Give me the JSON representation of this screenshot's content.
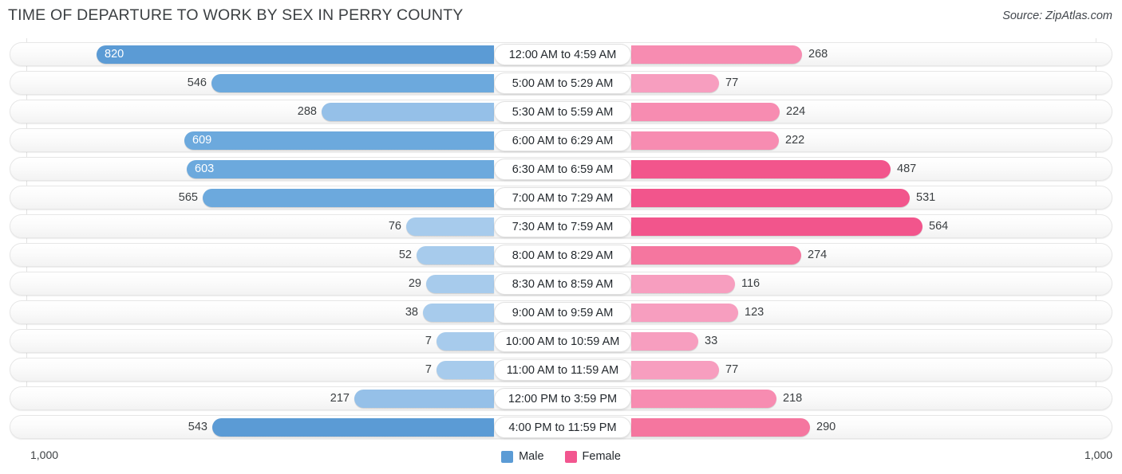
{
  "header": {
    "title": "TIME OF DEPARTURE TO WORK BY SEX IN PERRY COUNTY",
    "source": "Source: ZipAtlas.com"
  },
  "legend": {
    "male_label": "Male",
    "female_label": "Female",
    "male_color": "#5b9bd5",
    "female_color": "#f2568f"
  },
  "axis": {
    "left_label": "1,000",
    "right_label": "1,000"
  },
  "chart_data": {
    "type": "bar",
    "title": "TIME OF DEPARTURE TO WORK BY SEX IN PERRY COUNTY",
    "subtitle": "Source: ZipAtlas.com",
    "orientation": "horizontal-diverging",
    "xlabel": "",
    "ylabel": "",
    "xlim": [
      1000,
      1000
    ],
    "grid": true,
    "legend_position": "bottom-center",
    "categories": [
      "12:00 AM to 4:59 AM",
      "5:00 AM to 5:29 AM",
      "5:30 AM to 5:59 AM",
      "6:00 AM to 6:29 AM",
      "6:30 AM to 6:59 AM",
      "7:00 AM to 7:29 AM",
      "7:30 AM to 7:59 AM",
      "8:00 AM to 8:29 AM",
      "8:30 AM to 8:59 AM",
      "9:00 AM to 9:59 AM",
      "10:00 AM to 10:59 AM",
      "11:00 AM to 11:59 AM",
      "12:00 PM to 3:59 PM",
      "4:00 PM to 11:59 PM"
    ],
    "series": [
      {
        "name": "Male",
        "color": "#5b9bd5",
        "values": [
          820,
          546,
          288,
          609,
          603,
          565,
          76,
          52,
          29,
          38,
          7,
          7,
          217,
          543
        ],
        "labels": [
          "820",
          "546",
          "288",
          "609",
          "603",
          "565",
          "76",
          "52",
          "29",
          "38",
          "7",
          "7",
          "217",
          "543"
        ]
      },
      {
        "name": "Female",
        "color": "#f2568f",
        "values": [
          268,
          77,
          224,
          222,
          487,
          531,
          564,
          274,
          116,
          123,
          33,
          77,
          218,
          290
        ],
        "labels": [
          "268",
          "77",
          "224",
          "222",
          "487",
          "531",
          "564",
          "274",
          "116",
          "123",
          "33",
          "77",
          "218",
          "290"
        ]
      }
    ]
  },
  "rows": [
    {
      "label": "12:00 AM to 4:59 AM",
      "male": "820",
      "female": "268",
      "male_w": 498,
      "female_w": 214,
      "male_color": "#5b9bd5",
      "female_color": "#f78cb1",
      "male_inside": true
    },
    {
      "label": "5:00 AM to 5:29 AM",
      "male": "546",
      "female": "77",
      "male_w": 354,
      "female_w": 110,
      "male_color": "#6ca9dd",
      "female_color": "#f79ebf",
      "male_inside": false
    },
    {
      "label": "5:30 AM to 5:59 AM",
      "male": "288",
      "female": "224",
      "male_w": 216,
      "female_w": 186,
      "male_color": "#95c0e8",
      "female_color": "#f78cb1",
      "male_inside": false
    },
    {
      "label": "6:00 AM to 6:29 AM",
      "male": "609",
      "female": "222",
      "male_w": 388,
      "female_w": 185,
      "male_color": "#6ca9dd",
      "female_color": "#f78cb1",
      "male_inside": true
    },
    {
      "label": "6:30 AM to 6:59 AM",
      "male": "603",
      "female": "487",
      "male_w": 385,
      "female_w": 325,
      "male_color": "#6ca9dd",
      "female_color": "#f2558c",
      "male_inside": true
    },
    {
      "label": "7:00 AM to 7:29 AM",
      "male": "565",
      "female": "531",
      "male_w": 365,
      "female_w": 349,
      "male_color": "#6ca9dd",
      "female_color": "#f2558c",
      "male_inside": false
    },
    {
      "label": "7:30 AM to 7:59 AM",
      "male": "76",
      "female": "564",
      "male_w": 110,
      "female_w": 365,
      "male_color": "#a7cbec",
      "female_color": "#f2558c",
      "male_inside": false
    },
    {
      "label": "8:00 AM to 8:29 AM",
      "male": "52",
      "female": "274",
      "male_w": 97,
      "female_w": 213,
      "male_color": "#a7cbec",
      "female_color": "#f5769f",
      "male_inside": false
    },
    {
      "label": "8:30 AM to 8:59 AM",
      "male": "29",
      "female": "116",
      "male_w": 85,
      "female_w": 130,
      "male_color": "#a7cbec",
      "female_color": "#f79ebf",
      "male_inside": false
    },
    {
      "label": "9:00 AM to 9:59 AM",
      "male": "38",
      "female": "123",
      "male_w": 89,
      "female_w": 134,
      "male_color": "#a7cbec",
      "female_color": "#f79ebf",
      "male_inside": false
    },
    {
      "label": "10:00 AM to 10:59 AM",
      "male": "7",
      "female": "33",
      "male_w": 72,
      "female_w": 84,
      "male_color": "#a7cbec",
      "female_color": "#f79ebf",
      "male_inside": false
    },
    {
      "label": "11:00 AM to 11:59 AM",
      "male": "7",
      "female": "77",
      "male_w": 72,
      "female_w": 110,
      "male_color": "#a7cbec",
      "female_color": "#f79ebf",
      "male_inside": false
    },
    {
      "label": "12:00 PM to 3:59 PM",
      "male": "217",
      "female": "218",
      "male_w": 175,
      "female_w": 182,
      "male_color": "#95c0e8",
      "female_color": "#f78cb1",
      "male_inside": false
    },
    {
      "label": "4:00 PM to 11:59 PM",
      "male": "543",
      "female": "290",
      "male_w": 353,
      "female_w": 224,
      "male_color": "#5b9bd5",
      "female_color": "#f5769f",
      "male_inside": false
    }
  ]
}
